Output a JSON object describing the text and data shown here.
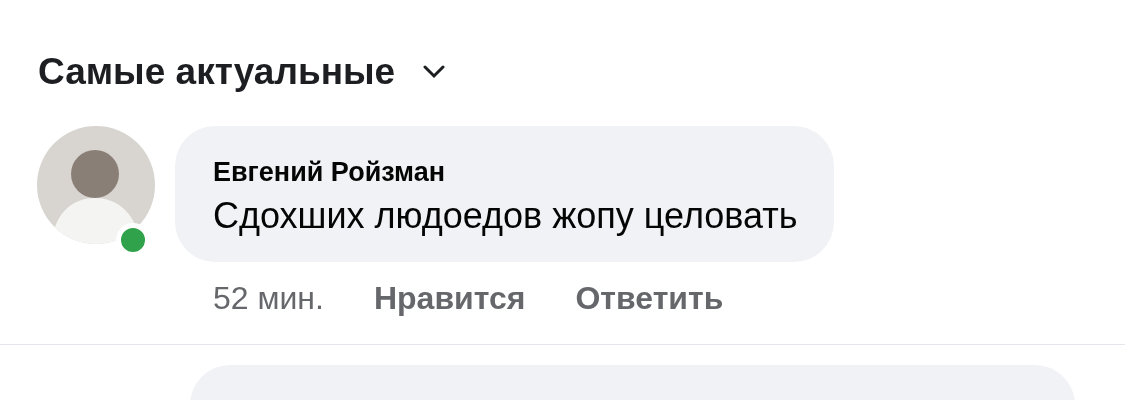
{
  "sort": {
    "label": "Самые актуальные"
  },
  "comments": [
    {
      "author": "Евгений Ройзман",
      "text": "Сдохших людоедов жопу целовать",
      "online": true,
      "time": "52 мин.",
      "actions": [
        "Нравится",
        "Ответить"
      ]
    }
  ]
}
